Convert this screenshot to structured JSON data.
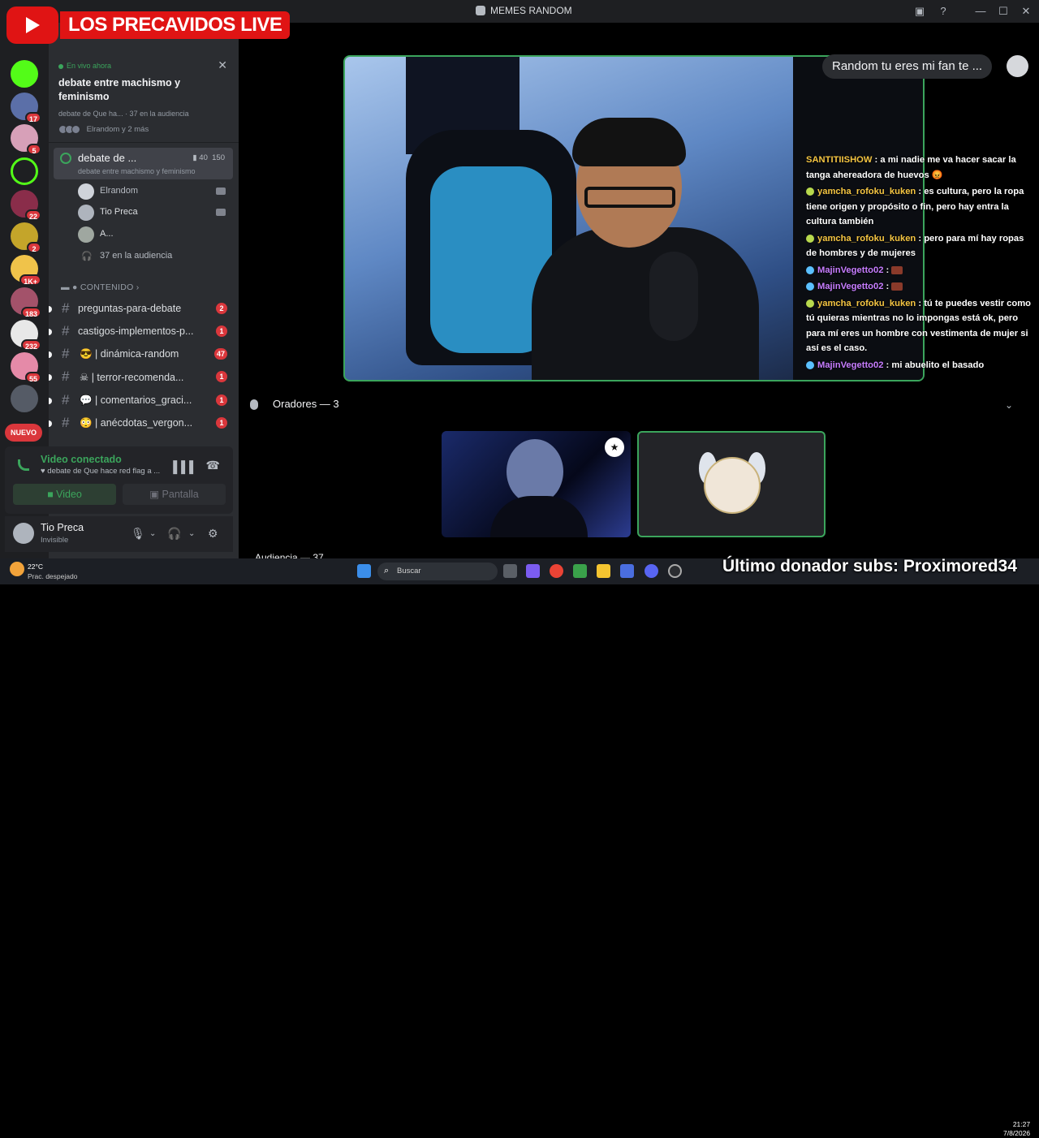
{
  "window": {
    "title": "MEMES RANDOM"
  },
  "overlay": {
    "stream_name": "LOS PRECAVIDOS LIVE",
    "donor_text": "Último donador subs: Proximored34"
  },
  "rail": {
    "badges": [
      "17",
      "5",
      "22",
      "2",
      "1K+",
      "183",
      "232",
      "55"
    ],
    "new_label": "NUEVO"
  },
  "live_now": {
    "label": "En vivo ahora",
    "title": "debate entre machismo y feminismo",
    "meta": "debate de Que ha... · 37 en la audiencia",
    "users": "Elrandom y 2 más"
  },
  "stage_channel": {
    "name": "debate de ...",
    "video_count": "40",
    "limit": "150",
    "topic": "debate entre machismo y feminismo"
  },
  "stage_members": [
    {
      "name": "Elrandom"
    },
    {
      "name": "Tio Preca"
    },
    {
      "name": "A..."
    }
  ],
  "audience_count_label": "37 en la audiencia",
  "category": "CONTENIDO",
  "channels": [
    {
      "name": "preguntas-para-debate",
      "badge": "2"
    },
    {
      "name": "castigos-implementos-p...",
      "badge": "1"
    },
    {
      "name": "| dinámica-random",
      "badge": "47"
    },
    {
      "name": "| terror-recomenda...",
      "badge": "1"
    },
    {
      "name": "| comentarios_graci...",
      "badge": "1"
    },
    {
      "name": "| anécdotas_vergon...",
      "badge": "1"
    }
  ],
  "voice": {
    "status": "Video conectado",
    "channel": "debate de Que hace red flag a ...",
    "video_btn": "Video",
    "screen_btn": "Pantalla"
  },
  "user": {
    "name": "Tio Preca",
    "status": "Invisible"
  },
  "main": {
    "pill_message": "Random tu eres mi fan te ...",
    "speakers_label": "Oradores — 3",
    "audience_label": "Audiencia — 37"
  },
  "chat": [
    {
      "user": "SANTITIISHOW",
      "text": "a mi nadie me va hacer sacar la tanga ahereadora de huevos 😡",
      "color": "#f5c542"
    },
    {
      "user": "yamcha_rofoku_kuken",
      "text": "es cultura, pero la ropa tiene origen y propósito o fin, pero hay entra la cultura también",
      "color": "#f5c542"
    },
    {
      "user": "yamcha_rofoku_kuken",
      "text": "pero para mí hay ropas de hombres y de mujeres",
      "color": "#f5c542"
    },
    {
      "user": "MajinVegetto02",
      "text": "",
      "color": "#c77dff"
    },
    {
      "user": "MajinVegetto02",
      "text": "",
      "color": "#c77dff"
    },
    {
      "user": "yamcha_rofoku_kuken",
      "text": "tú te puedes vestir como tú quieras mientras no lo impongas está ok, pero para mí eres un hombre con vestimenta de mujer si así es el caso.",
      "color": "#f5c542"
    },
    {
      "user": "MajinVegetto02",
      "text": "mi abuelito el basado",
      "color": "#c77dff"
    }
  ],
  "taskbar": {
    "temp": "22°C",
    "condition": "Prac. despejado",
    "search": "Buscar",
    "time": "21:27",
    "date": "7/8/2026"
  }
}
